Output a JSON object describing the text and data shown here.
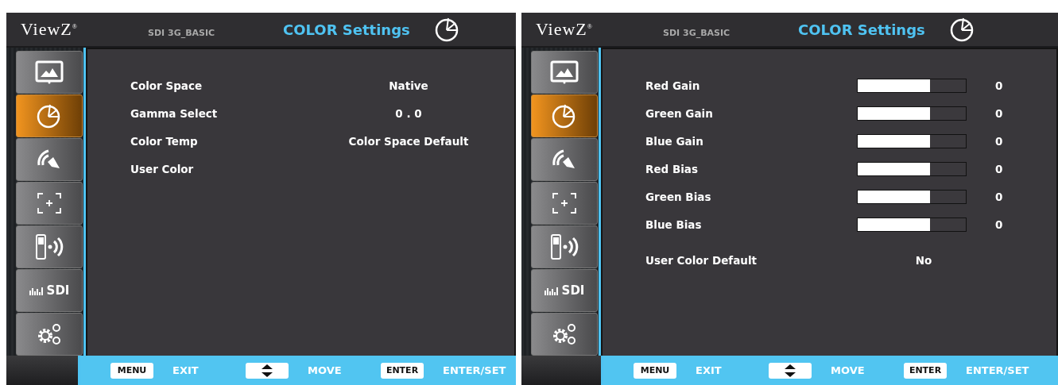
{
  "panels": [
    {
      "header": {
        "logo": "ViewZ$^{®}$",
        "source": "SDI 3G_BASIC",
        "title": "COLOR Settings"
      },
      "sidebar": [
        {
          "kind": "picture",
          "selected": false
        },
        {
          "kind": "color",
          "selected": true
        },
        {
          "kind": "audio",
          "selected": false
        },
        {
          "kind": "zoom",
          "selected": false
        },
        {
          "kind": "remote",
          "selected": false
        },
        {
          "kind": "sdi",
          "label": "SDI",
          "selected": false
        },
        {
          "kind": "settings",
          "selected": false
        }
      ],
      "rows": [
        {
          "kind": "option",
          "label": "Color Space",
          "value": "Native"
        },
        {
          "kind": "option",
          "label": "Gamma Select",
          "value": "0 . 0"
        },
        {
          "kind": "option",
          "label": "Color Temp",
          "value": "Color Space Default"
        },
        {
          "kind": "option",
          "label": "User Color"
        }
      ],
      "footer": [
        {
          "kind": "text",
          "key": "MENU",
          "label": "EXIT"
        },
        {
          "kind": "arrows",
          "label": "MOVE"
        },
        {
          "kind": "text",
          "key": "ENTER",
          "label": "ENTER/SET"
        }
      ]
    },
    {
      "header": {
        "logo": "ViewZ$^{®}$",
        "source": "SDI 3G_BASIC",
        "title": "COLOR Settings"
      },
      "sidebar": [
        {
          "kind": "picture",
          "selected": false
        },
        {
          "kind": "color",
          "selected": true
        },
        {
          "kind": "audio",
          "selected": false
        },
        {
          "kind": "zoom",
          "selected": false
        },
        {
          "kind": "remote",
          "selected": false
        },
        {
          "kind": "sdi",
          "label": "SDI",
          "selected": false
        },
        {
          "kind": "settings",
          "selected": false
        }
      ],
      "rows": [
        {
          "kind": "slider",
          "label": "Red Gain",
          "level": 0.67,
          "value": "0"
        },
        {
          "kind": "slider",
          "label": "Green Gain",
          "level": 0.67,
          "value": "0"
        },
        {
          "kind": "slider",
          "label": "Blue Gain",
          "level": 0.67,
          "value": "0"
        },
        {
          "kind": "slider",
          "label": "Red Bias",
          "level": 0.67,
          "value": "0"
        },
        {
          "kind": "slider",
          "label": "Green Bias",
          "level": 0.67,
          "value": "0"
        },
        {
          "kind": "slider",
          "label": "Blue Bias",
          "level": 0.67,
          "value": "0"
        },
        {
          "kind": "gap"
        },
        {
          "kind": "option",
          "label": "User Color Default",
          "value": "No"
        }
      ],
      "footer": [
        {
          "kind": "text",
          "key": "MENU",
          "label": "EXIT"
        },
        {
          "kind": "arrows",
          "label": "MOVE"
        },
        {
          "kind": "text",
          "key": "ENTER",
          "label": "ENTER/SET"
        }
      ]
    }
  ]
}
